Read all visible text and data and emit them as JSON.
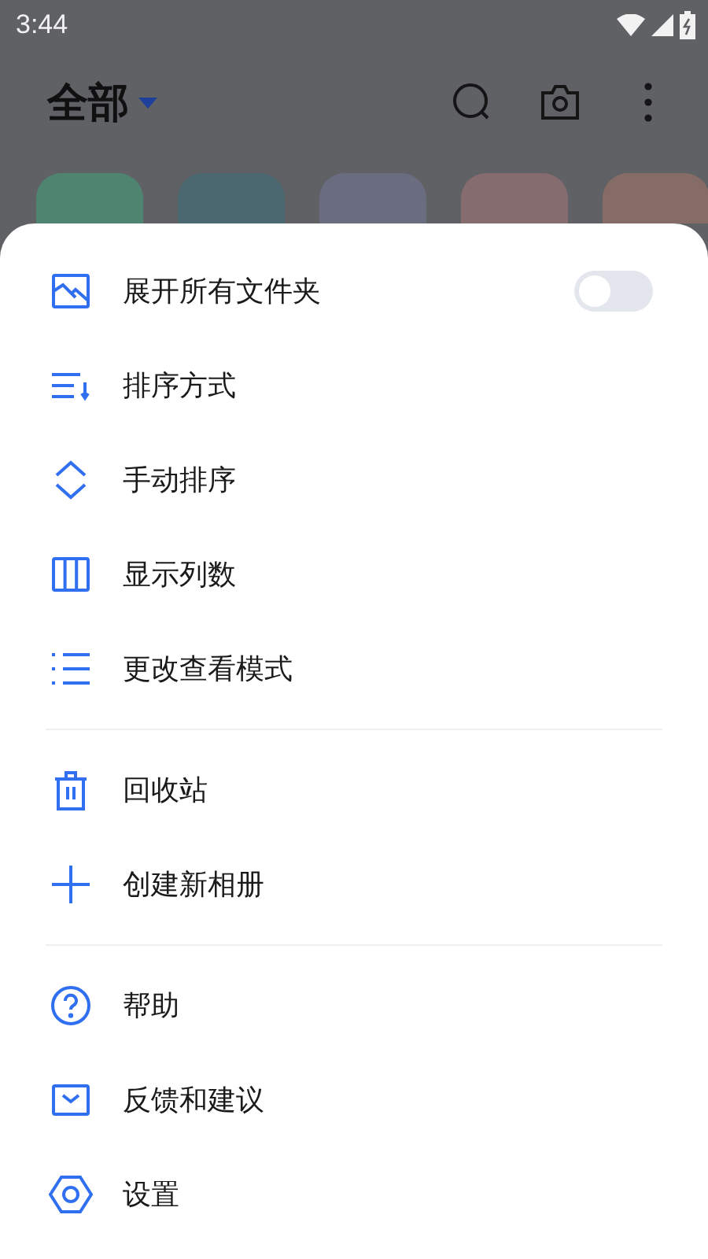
{
  "status_bar": {
    "time": "3:44"
  },
  "header": {
    "title": "全部"
  },
  "menu": {
    "sections": [
      {
        "items": [
          {
            "kind": "toggle",
            "label": "展开所有文件夹",
            "on": false
          },
          {
            "kind": "plain",
            "label": "排序方式"
          },
          {
            "kind": "plain",
            "label": "手动排序"
          },
          {
            "kind": "plain",
            "label": "显示列数"
          },
          {
            "kind": "plain",
            "label": "更改查看模式"
          }
        ]
      },
      {
        "items": [
          {
            "kind": "plain",
            "label": "回收站"
          },
          {
            "kind": "plain",
            "label": "创建新相册"
          }
        ]
      },
      {
        "items": [
          {
            "kind": "plain",
            "label": "帮助"
          },
          {
            "kind": "plain",
            "label": "反馈和建议"
          },
          {
            "kind": "plain",
            "label": "设置"
          }
        ]
      }
    ]
  }
}
